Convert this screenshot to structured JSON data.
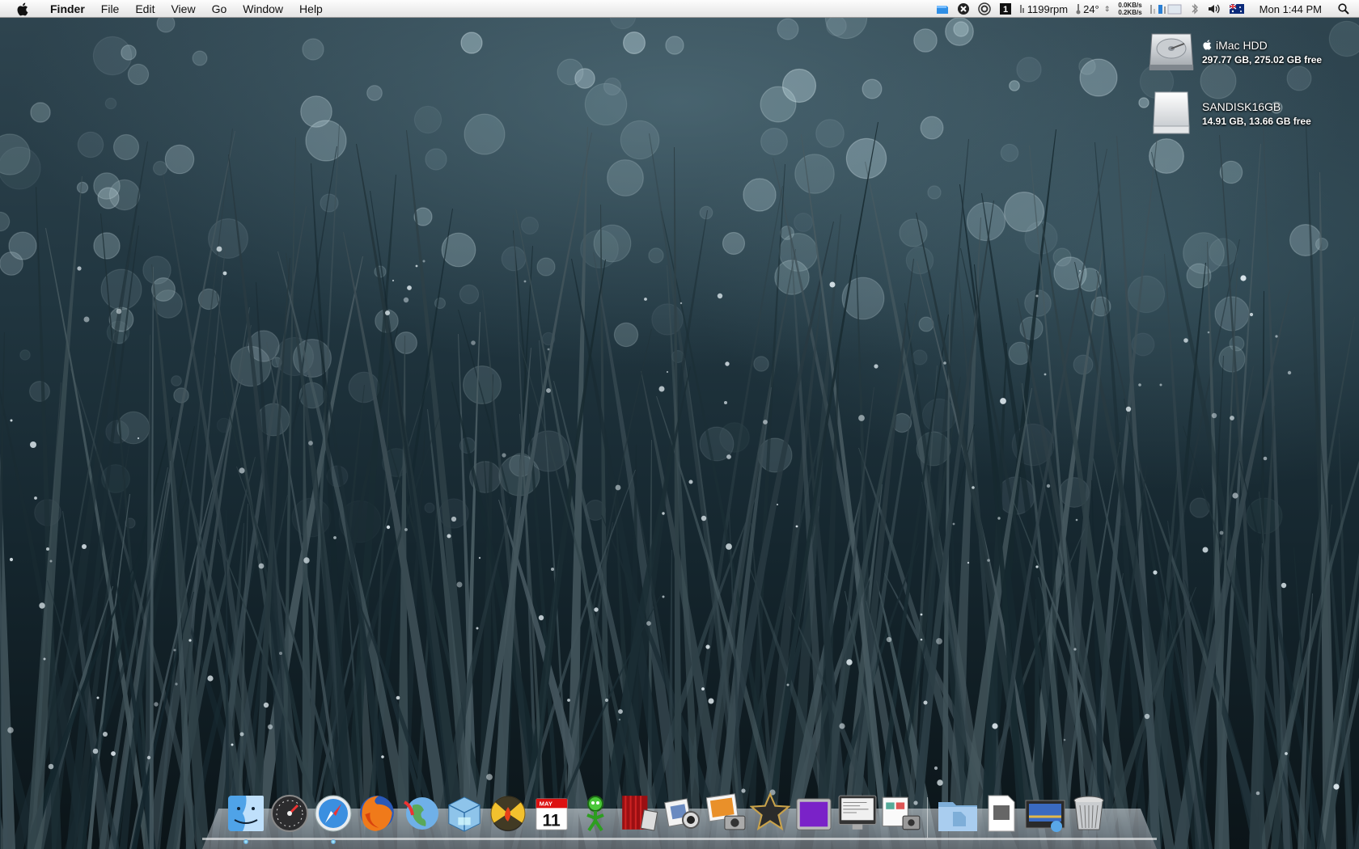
{
  "menubar": {
    "apple_icon": "apple-icon",
    "app_name": "Finder",
    "menus": [
      "File",
      "Edit",
      "View",
      "Go",
      "Window",
      "Help"
    ],
    "status": {
      "fan_speed": "1199rpm",
      "temperature": "24°",
      "net_down": "0.0KB/s",
      "net_up": "0.2KB/s",
      "clock": "Mon 1:44 PM",
      "icons": [
        "dropbox-icon",
        "x-circle-icon",
        "gear-icon",
        "spaces-icon",
        "cpu-meter-icon",
        "battery-icon",
        "bluetooth-icon",
        "volume-icon",
        "australia-flag-icon",
        "spotlight-icon"
      ]
    }
  },
  "desktop": {
    "drives": [
      {
        "name": "iMac HDD",
        "info": "297.77 GB, 275.02 GB free",
        "icon": "hard-drive-icon"
      },
      {
        "name": "SANDISK16GB",
        "info": "14.91 GB, 13.66 GB free",
        "icon": "usb-drive-icon"
      }
    ]
  },
  "dock": {
    "apps": [
      {
        "name": "Finder",
        "icon": "finder-icon",
        "running": true
      },
      {
        "name": "Dashboard",
        "icon": "dashboard-icon",
        "running": false
      },
      {
        "name": "Safari",
        "icon": "safari-icon",
        "running": true
      },
      {
        "name": "Firefox",
        "icon": "firefox-icon",
        "running": false
      },
      {
        "name": "Network",
        "icon": "globe-icon",
        "running": false
      },
      {
        "name": "VirtualBox",
        "icon": "virtualbox-icon",
        "running": false
      },
      {
        "name": "Burn",
        "icon": "burn-icon",
        "running": false
      },
      {
        "name": "iCal",
        "icon": "calendar-icon",
        "running": false
      },
      {
        "name": "Adium",
        "icon": "adium-icon",
        "running": false
      },
      {
        "name": "Front Row",
        "icon": "front-row-icon",
        "running": false
      },
      {
        "name": "iChat",
        "icon": "ichat-icon",
        "running": false
      },
      {
        "name": "iPhoto",
        "icon": "iphoto-icon",
        "running": false
      },
      {
        "name": "iMovie",
        "icon": "imovie-icon",
        "running": false
      },
      {
        "name": "Screen",
        "icon": "purple-screen-icon",
        "running": false
      },
      {
        "name": "Activity Monitor",
        "icon": "monitor-icon",
        "running": false
      },
      {
        "name": "Preview",
        "icon": "preview-icon",
        "running": false
      }
    ],
    "stacks": [
      {
        "name": "Documents",
        "icon": "folder-icon"
      },
      {
        "name": "Downloads",
        "icon": "document-icon"
      },
      {
        "name": "Screenshots",
        "icon": "screenshot-icon"
      },
      {
        "name": "Trash",
        "icon": "trash-icon"
      }
    ],
    "calendar": {
      "month": "MAY",
      "day": "11"
    }
  },
  "colors": {
    "menubar_bg": "#eeeeee",
    "wallpaper_dark": "#0e1a20",
    "wallpaper_mid": "#2f4550"
  }
}
